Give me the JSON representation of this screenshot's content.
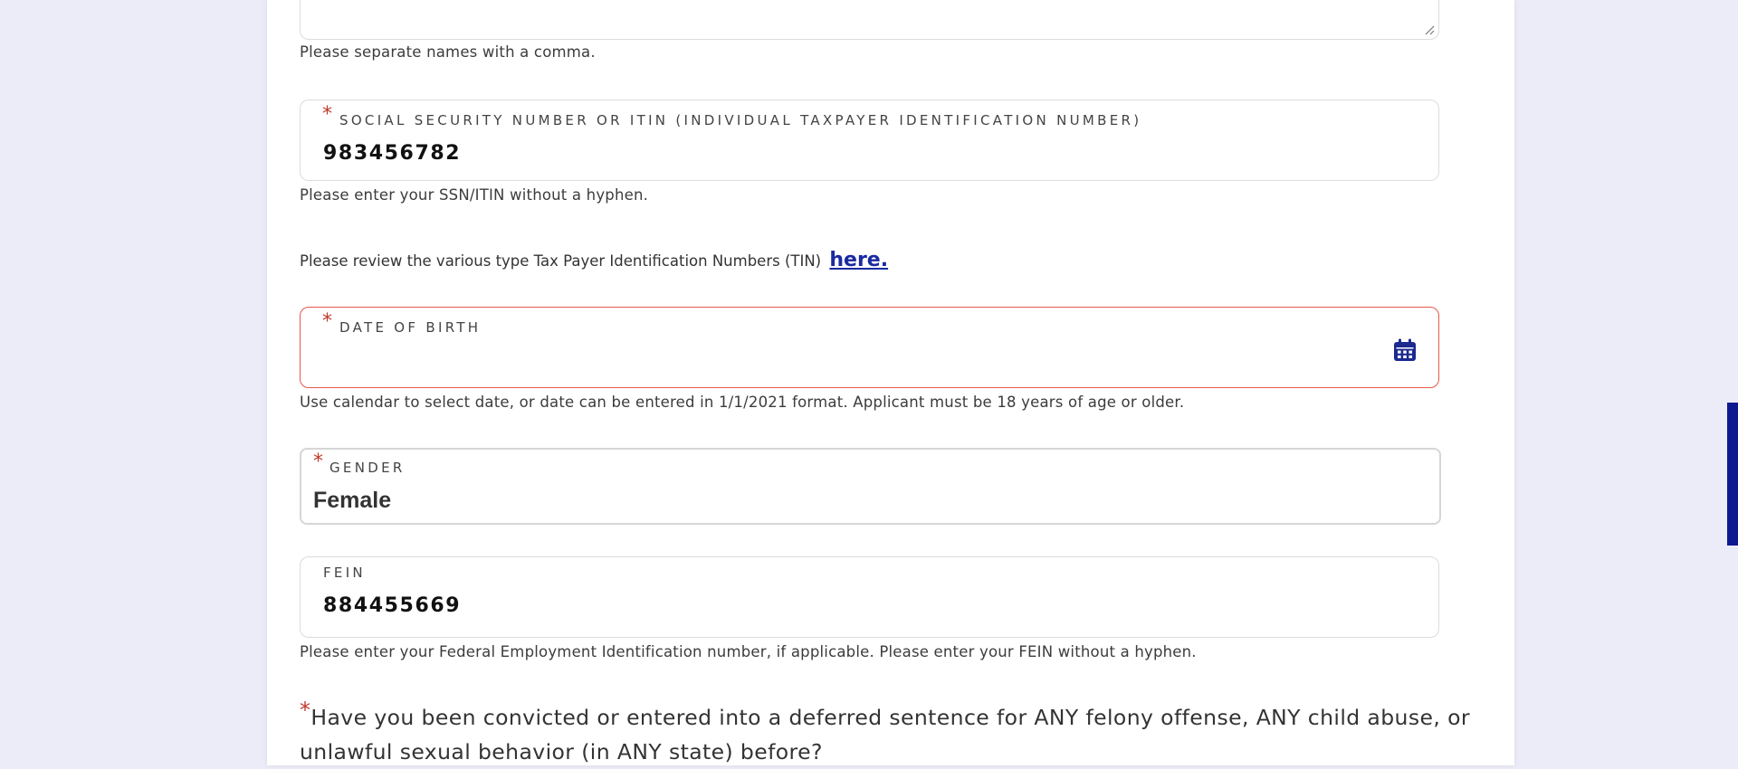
{
  "names_help": "Please separate names with a comma.",
  "ssn": {
    "label": "SOCIAL SECURITY NUMBER OR ITIN (INDIVIDUAL TAXPAYER IDENTIFICATION NUMBER)",
    "value": "983456782",
    "help": "Please enter your SSN/ITIN without a hyphen."
  },
  "tin_review": {
    "text": "Please review the various type Tax Payer Identification Numbers (TIN)",
    "link": "here."
  },
  "dob": {
    "label": "DATE OF BIRTH",
    "value": "",
    "help": "Use calendar to select date, or date can be entered in 1/1/2021 format. Applicant must be 18 years of age or older."
  },
  "gender": {
    "label": "GENDER",
    "value": "Female"
  },
  "fein": {
    "label": "FEIN",
    "value": "884455669",
    "help": "Please enter your Federal Employment Identification number, if applicable. Please enter your FEIN without a hyphen."
  },
  "required_marker": "*",
  "question": "Have you been convicted or entered into a deferred sentence for ANY felony offense, ANY child abuse, or unlawful sexual behavior (in ANY state) before?",
  "colors": {
    "accent": "#1a2aa0",
    "required": "#c0392b",
    "error_border": "#e8574a",
    "scrollbar": "#0d1a8f"
  },
  "icons": {
    "calendar": "calendar-icon",
    "resize": "resize-handle-icon"
  }
}
